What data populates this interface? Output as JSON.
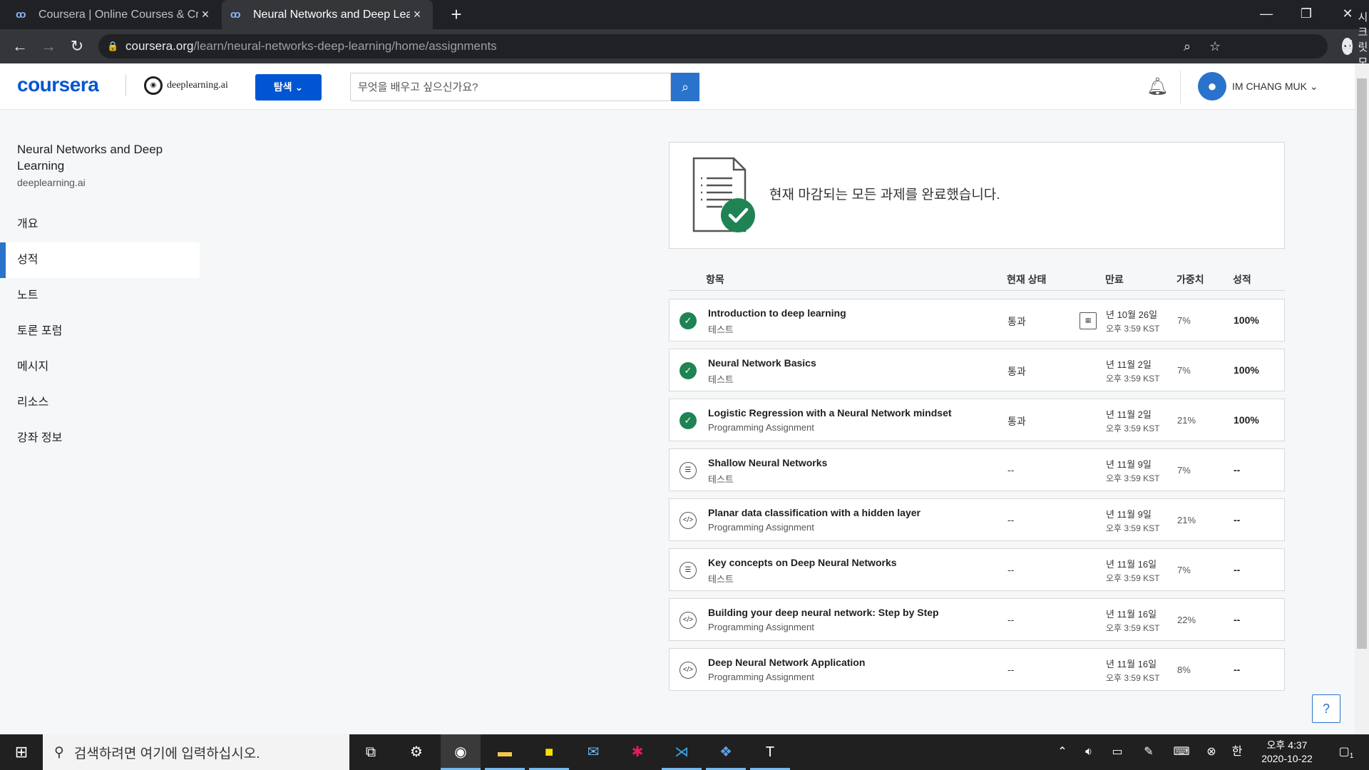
{
  "browser": {
    "tabs": [
      {
        "title": "Coursera | Online Courses & Cr"
      },
      {
        "title": "Neural Networks and Deep Lear"
      }
    ],
    "url_host": "coursera.org",
    "url_path": "/learn/neural-networks-deep-learning/home/assignments",
    "incognito_label": "시크릿 모드"
  },
  "header": {
    "logo": "coursera",
    "partner": "deeplearning.ai",
    "explore_label": "탐색 ⌄",
    "search_placeholder": "무엇을 배우고 싶으신가요?",
    "user_name": "IM CHANG MUK ⌄"
  },
  "sidebar": {
    "course_title": "Neural Networks and Deep Learning",
    "course_partner": "deeplearning.ai",
    "items": [
      {
        "label": "개요"
      },
      {
        "label": "성적"
      },
      {
        "label": "노트"
      },
      {
        "label": "토론 포럼"
      },
      {
        "label": "메시지"
      },
      {
        "label": "리소스"
      },
      {
        "label": "강좌 정보"
      }
    ]
  },
  "banner": {
    "message": "현재 마감되는 모든 과제를 완료했습니다."
  },
  "table": {
    "headers": {
      "item": "항목",
      "status": "현재 상태",
      "due": "만료",
      "weight": "가중치",
      "grade": "성적"
    },
    "rows": [
      {
        "name": "Introduction to deep learning",
        "kind": "테스트",
        "status": "통과",
        "due_date": "년 10월 26일",
        "due_time": "오후 3:59 KST",
        "weight": "7%",
        "grade": "100%",
        "done": true
      },
      {
        "name": "Neural Network Basics",
        "kind": "테스트",
        "status": "통과",
        "due_date": "년 11월 2일",
        "due_time": "오후 3:59 KST",
        "weight": "7%",
        "grade": "100%",
        "done": true
      },
      {
        "name": "Logistic Regression with a Neural Network mindset",
        "kind": "Programming Assignment",
        "status": "통과",
        "due_date": "년 11월 2일",
        "due_time": "오후 3:59 KST",
        "weight": "21%",
        "grade": "100%",
        "done": true
      },
      {
        "name": "Shallow Neural Networks",
        "kind": "테스트",
        "status": "--",
        "due_date": "년 11월 9일",
        "due_time": "오후 3:59 KST",
        "weight": "7%",
        "grade": "--",
        "done": false
      },
      {
        "name": "Planar data classification with a hidden layer",
        "kind": "Programming Assignment",
        "status": "--",
        "due_date": "년 11월 9일",
        "due_time": "오후 3:59 KST",
        "weight": "21%",
        "grade": "--",
        "done": false
      },
      {
        "name": "Key concepts on Deep Neural Networks",
        "kind": "테스트",
        "status": "--",
        "due_date": "년 11월 16일",
        "due_time": "오후 3:59 KST",
        "weight": "7%",
        "grade": "--",
        "done": false
      },
      {
        "name": "Building your deep neural network: Step by Step",
        "kind": "Programming Assignment",
        "status": "--",
        "due_date": "년 11월 16일",
        "due_time": "오후 3:59 KST",
        "weight": "22%",
        "grade": "--",
        "done": false
      },
      {
        "name": "Deep Neural Network Application",
        "kind": "Programming Assignment",
        "status": "--",
        "due_date": "년 11월 16일",
        "due_time": "오후 3:59 KST",
        "weight": "8%",
        "grade": "--",
        "done": false
      }
    ]
  },
  "taskbar": {
    "search_placeholder": "검색하려면 여기에 입력하십시오.",
    "time": "오후 4:37",
    "date": "2020-10-22",
    "ime": "한",
    "notification_count": "1"
  },
  "colors": {
    "brand": "#0056d2",
    "accent": "#2a73cc",
    "success": "#1f8354"
  }
}
